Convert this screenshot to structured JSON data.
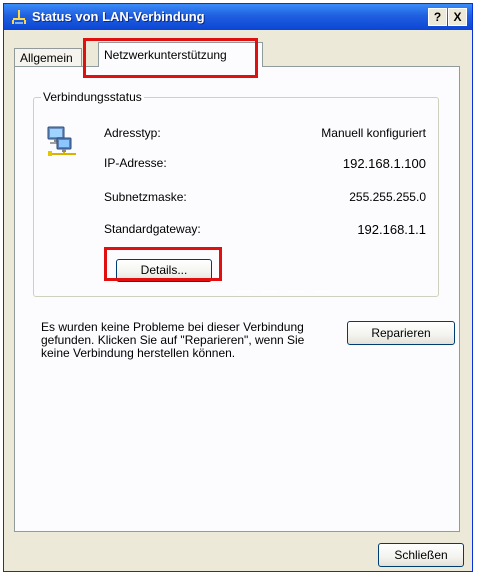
{
  "window": {
    "title": "Status von LAN-Verbindung",
    "help_label": "?",
    "close_label": "X"
  },
  "tabs": [
    {
      "label": "Allgemein",
      "active": false
    },
    {
      "label": "Netzwerkunterstützung",
      "active": true
    }
  ],
  "connection_status": {
    "group_title": "Verbindungsstatus",
    "rows": [
      {
        "label": "Adresstyp:",
        "value": "Manuell konfiguriert"
      },
      {
        "label": "IP-Adresse:",
        "value": "192.168.1.100"
      },
      {
        "label": "Subnetzmaske:",
        "value": "255.255.255.0"
      },
      {
        "label": "Standardgateway:",
        "value": "192.168.1.1"
      }
    ],
    "details_label": "Details..."
  },
  "repair": {
    "message": "Es wurden keine Probleme bei dieser Verbindung gefunden. Klicken Sie auf \"Reparieren\", wenn Sie keine Verbindung herstellen können.",
    "button_label": "Reparieren"
  },
  "footer": {
    "close_label": "Schließen"
  },
  "colors": {
    "titlebar": "#0b46d4",
    "dialog_bg": "#ece9d8",
    "highlight": "#e01010"
  }
}
